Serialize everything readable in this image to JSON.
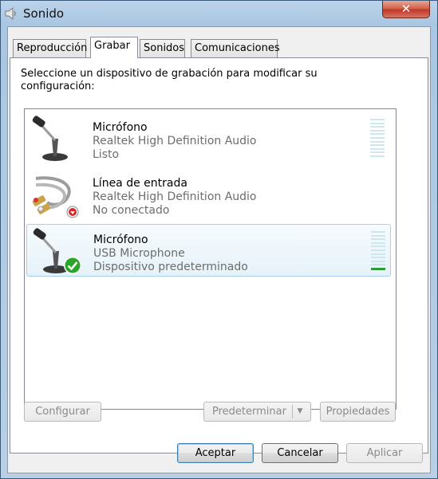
{
  "window": {
    "title": "Sonido",
    "close_label": "✕"
  },
  "tabs": [
    {
      "label": "Reproducción",
      "active": false
    },
    {
      "label": "Grabar",
      "active": true
    },
    {
      "label": "Sonidos",
      "active": false
    },
    {
      "label": "Comunicaciones",
      "active": false
    }
  ],
  "instruction": "Seleccione un dispositivo de grabación para modificar su configuración:",
  "devices": [
    {
      "name": "Micrófono",
      "description": "Realtek High Definition Audio",
      "status": "Listo",
      "icon": "microphone-icon",
      "badge": null,
      "level": 0
    },
    {
      "name": "Línea de entrada",
      "description": "Realtek High Definition Audio",
      "status": "No conectado",
      "icon": "line-in-cable-icon",
      "badge": "not-connected-badge-icon",
      "level": 0
    },
    {
      "name": "Micrófono",
      "description": "USB Microphone",
      "status": "Dispositivo predeterminado",
      "icon": "microphone-icon",
      "badge": "default-checkmark-badge-icon",
      "level": 0.1
    }
  ],
  "buttons": {
    "configure": "Configurar",
    "set_default": "Predeterminar",
    "properties": "Propiedades",
    "accept": "Aceptar",
    "cancel": "Cancelar",
    "apply": "Aplicar"
  },
  "colors": {
    "selection_border": "#a3d0f0",
    "meter_idle": "#cfe6ec",
    "meter_active": "#2f9a3a",
    "check_badge": "#2aa52a"
  }
}
